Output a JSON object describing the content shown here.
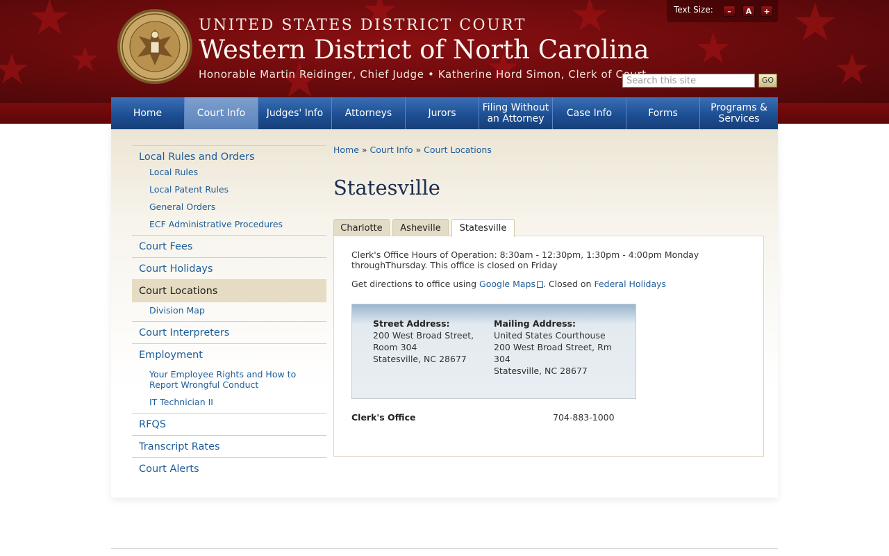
{
  "header": {
    "court_line": "UNITED STATES DISTRICT COURT",
    "district_title": "Western District of North Carolina",
    "judge_line": "Honorable Martin Reidinger, Chief Judge • Katherine Hord Simon, Clerk of Court",
    "text_size_label": "Text Size:",
    "text_size_buttons": [
      "–",
      "A",
      "+"
    ],
    "search_placeholder": "Search this site",
    "go_label": "GO",
    "seal_icon": "court-seal-icon"
  },
  "nav": {
    "items": [
      {
        "label": "Home"
      },
      {
        "label": "Court Info",
        "active": true
      },
      {
        "label": "Judges' Info"
      },
      {
        "label": "Attorneys"
      },
      {
        "label": "Jurors"
      },
      {
        "label": "Filing Without an Attorney"
      },
      {
        "label": "Case Info"
      },
      {
        "label": "Forms"
      },
      {
        "label": "Programs & Services"
      }
    ]
  },
  "sidebar": {
    "local_rules": {
      "label": "Local Rules and Orders",
      "children": [
        "Local Rules",
        "Local Patent Rules",
        "General Orders",
        "ECF Administrative Procedures"
      ]
    },
    "court_fees": "Court Fees",
    "court_holidays": "Court Holidays",
    "court_locations": {
      "label": "Court Locations",
      "children": [
        "Division Map"
      ]
    },
    "court_interpreters": "Court Interpreters",
    "employment": {
      "label": "Employment",
      "children": [
        "Your Employee Rights and How to Report Wrongful Conduct",
        "IT Technician II"
      ]
    },
    "rfqs": "RFQS",
    "transcript_rates": "Transcript Rates",
    "court_alerts": "Court Alerts"
  },
  "breadcrumb": {
    "items": [
      "Home",
      "Court Info",
      "Court Locations"
    ],
    "separator": "»"
  },
  "page_title": "Statesville",
  "tabs": [
    {
      "label": "Charlotte"
    },
    {
      "label": "Asheville"
    },
    {
      "label": "Statesville",
      "active": true
    }
  ],
  "panel": {
    "hours": "Clerk's Office Hours of Operation: 8:30am - 12:30pm, 1:30pm - 4:00pm Monday throughThursday.  This office is closed on Friday",
    "directions_prefix": "Get directions to office using ",
    "maps_link": "Google Maps",
    "closed_text": ". Closed on ",
    "holidays_link": "Federal Holidays",
    "street": {
      "heading": "Street Address:",
      "line1": "200 West Broad Street,",
      "line2": "Room 304",
      "line3": "Statesville, NC  28677"
    },
    "mailing": {
      "heading": "Mailing Address:",
      "line1": "United States Courthouse",
      "line2": "200 West Broad Street, Rm",
      "line3": "304",
      "line4": "Statesville, NC  28677"
    },
    "contact": {
      "label": "Clerk's Office",
      "phone": "704-883-1000"
    }
  },
  "colors": {
    "header_red": "#6e0b0d",
    "nav_blue": "#1d4f93",
    "link_blue": "#1d5d9b",
    "sidebar_active": "#e6dcc3"
  }
}
